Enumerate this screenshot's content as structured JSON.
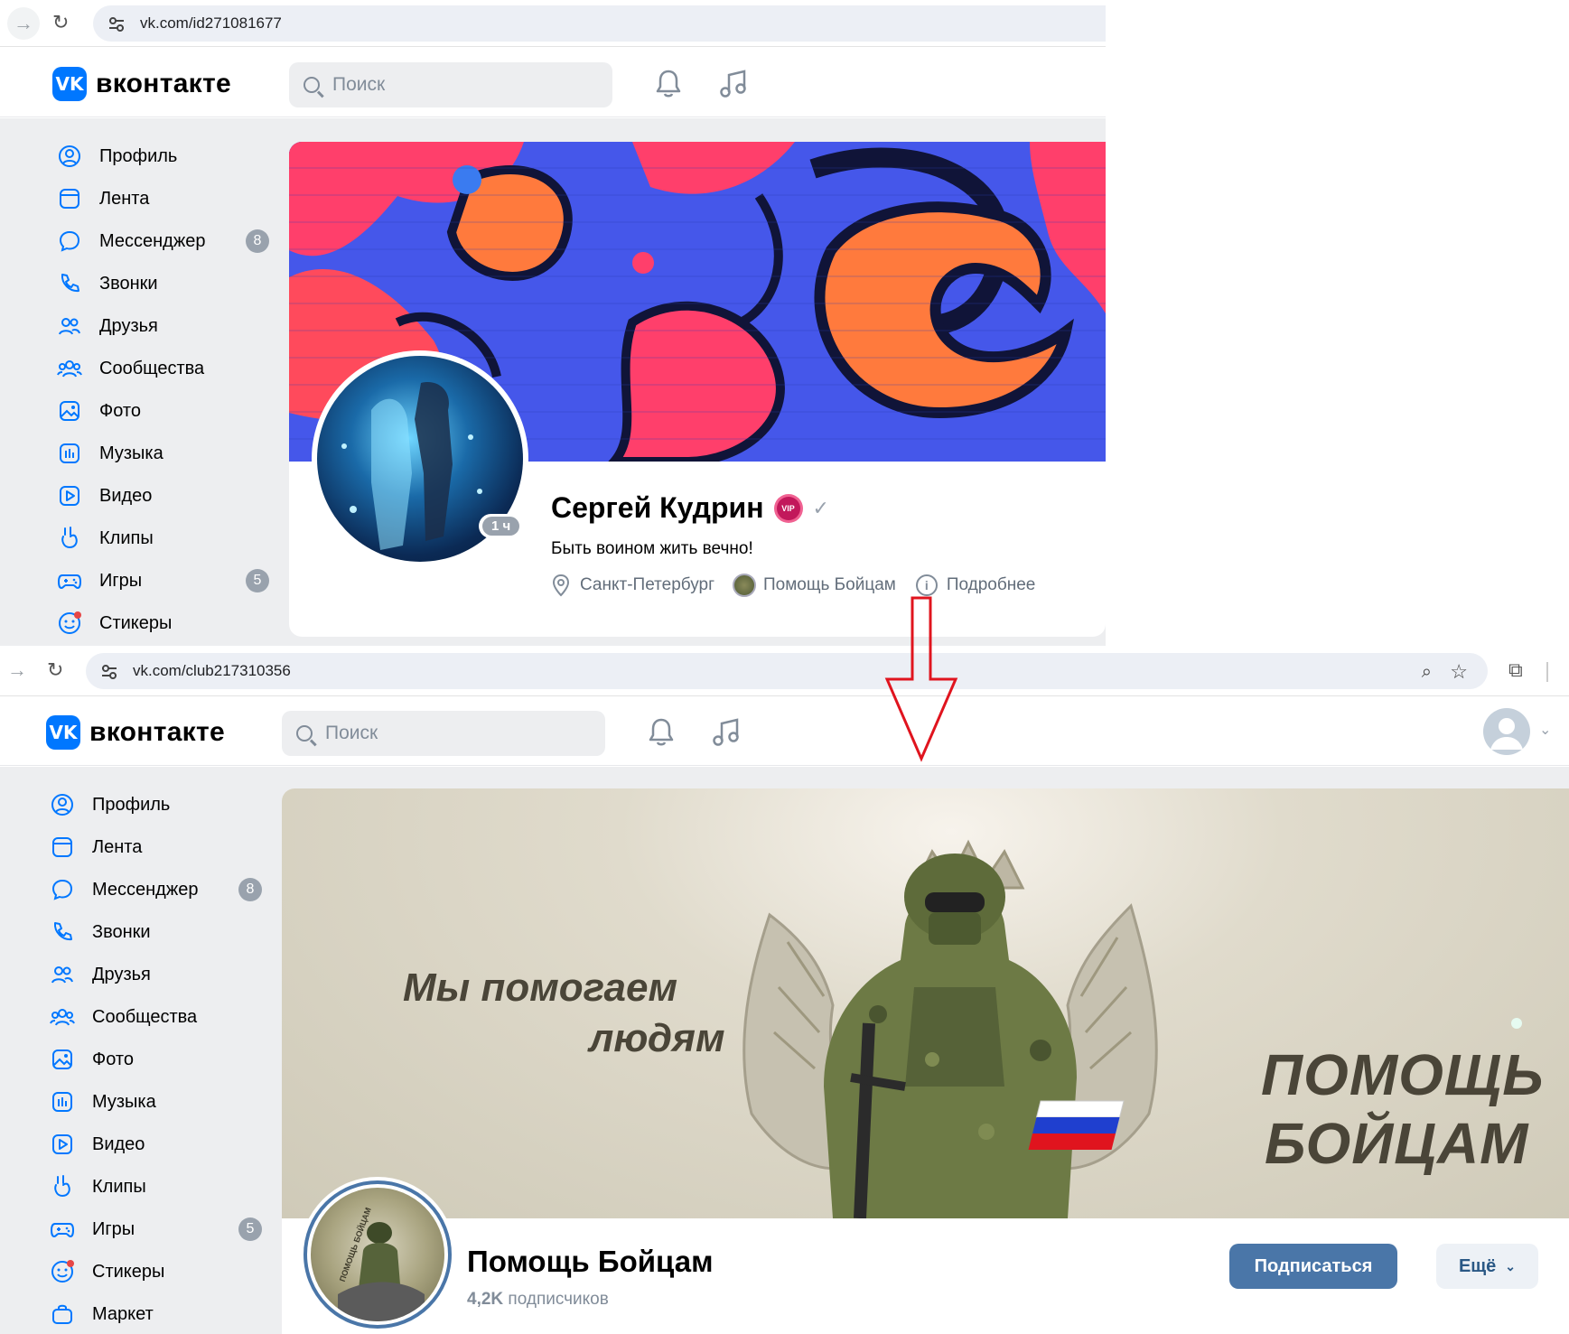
{
  "top": {
    "url": "vk.com/id271081677",
    "logo_text": "вконтакте",
    "search_placeholder": "Поиск",
    "profile": {
      "name": "Сергей Кудрин",
      "status": "Быть воином жить вечно!",
      "online_badge": "1 ч",
      "city": "Санкт-Петербург",
      "group": "Помощь Бойцам",
      "more": "Подробнее",
      "vip_label": "VIP"
    }
  },
  "bottom": {
    "url": "vk.com/club217310356",
    "logo_text": "вконтакте",
    "search_placeholder": "Поиск",
    "cover": {
      "slogan_line1": "Мы помогаем",
      "slogan_line2": "людям",
      "title_line1": "ПОМОЩЬ",
      "title_line2": "БОЙЦАМ"
    },
    "avatar_text": "ПОМОЩЬ БОЙЦАМ",
    "group": {
      "name": "Помощь Бойцам",
      "subscribers_count": "4,2K",
      "subscribers_label": "подписчиков",
      "subscribe_button": "Подписаться",
      "more_button": "Ещё"
    }
  },
  "sidebar_top": [
    {
      "label": "Профиль",
      "icon": "profile-icon"
    },
    {
      "label": "Лента",
      "icon": "feed-icon"
    },
    {
      "label": "Мессенджер",
      "icon": "messenger-icon",
      "badge": "8"
    },
    {
      "label": "Звонки",
      "icon": "phone-icon"
    },
    {
      "label": "Друзья",
      "icon": "friends-icon"
    },
    {
      "label": "Сообщества",
      "icon": "communities-icon"
    },
    {
      "label": "Фото",
      "icon": "photo-icon"
    },
    {
      "label": "Музыка",
      "icon": "music-icon"
    },
    {
      "label": "Видео",
      "icon": "video-icon"
    },
    {
      "label": "Клипы",
      "icon": "clips-icon"
    },
    {
      "label": "Игры",
      "icon": "games-icon",
      "badge": "5"
    },
    {
      "label": "Стикеры",
      "icon": "stickers-icon"
    }
  ],
  "sidebar_bottom": [
    {
      "label": "Профиль",
      "icon": "profile-icon"
    },
    {
      "label": "Лента",
      "icon": "feed-icon"
    },
    {
      "label": "Мессенджер",
      "icon": "messenger-icon",
      "badge": "8"
    },
    {
      "label": "Звонки",
      "icon": "phone-icon"
    },
    {
      "label": "Друзья",
      "icon": "friends-icon"
    },
    {
      "label": "Сообщества",
      "icon": "communities-icon"
    },
    {
      "label": "Фото",
      "icon": "photo-icon"
    },
    {
      "label": "Музыка",
      "icon": "music-icon"
    },
    {
      "label": "Видео",
      "icon": "video-icon"
    },
    {
      "label": "Клипы",
      "icon": "clips-icon"
    },
    {
      "label": "Игры",
      "icon": "games-icon",
      "badge": "5"
    },
    {
      "label": "Стикеры",
      "icon": "stickers-icon"
    },
    {
      "label": "Маркет",
      "icon": "market-icon"
    }
  ],
  "colors": {
    "vk_blue": "#0077ff",
    "subscribe_blue": "#4a76a8",
    "arrow_red": "#e0141e",
    "page_gray": "#edeef0"
  }
}
